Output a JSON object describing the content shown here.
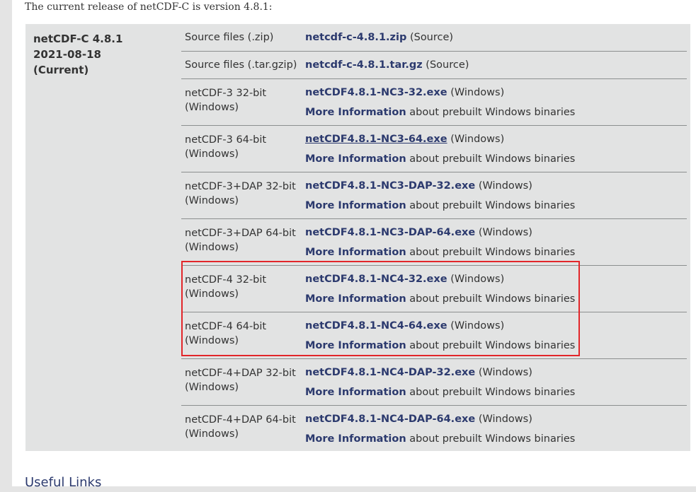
{
  "intro": "The current release of netCDF-C is version 4.8.1:",
  "release": {
    "name": "netCDF-C 4.8.1",
    "date": "2021-08-18",
    "status": "(Current)"
  },
  "rows": [
    {
      "label": "Source files (.zip)",
      "file": "netcdf-c-4.8.1.zip",
      "suffix": "(Source)"
    },
    {
      "label": "Source files (.tar.gzip)",
      "file": "netcdf-c-4.8.1.tar.gz",
      "suffix": "(Source)"
    },
    {
      "label": "netCDF-3 32-bit (Windows)",
      "file": "netCDF4.8.1-NC3-32.exe",
      "suffix": "(Windows)",
      "more": "More Information",
      "more_suffix": "about prebuilt Windows binaries"
    },
    {
      "label": "netCDF-3 64-bit (Windows)",
      "file": "netCDF4.8.1-NC3-64.exe",
      "suffix": "(Windows)",
      "more": "More Information",
      "more_suffix": "about prebuilt Windows binaries"
    },
    {
      "label": "netCDF-3+DAP 32-bit (Windows)",
      "file": "netCDF4.8.1-NC3-DAP-32.exe",
      "suffix": "(Windows)",
      "more": "More Information",
      "more_suffix": "about prebuilt Windows binaries"
    },
    {
      "label": "netCDF-3+DAP 64-bit (Windows)",
      "file": "netCDF4.8.1-NC3-DAP-64.exe",
      "suffix": "(Windows)",
      "more": "More Information",
      "more_suffix": "about prebuilt Windows binaries"
    },
    {
      "label": "netCDF-4 32-bit (Windows)",
      "file": "netCDF4.8.1-NC4-32.exe",
      "suffix": "(Windows)",
      "more": "More Information",
      "more_suffix": "about prebuilt Windows binaries"
    },
    {
      "label": "netCDF-4 64-bit (Windows)",
      "file": "netCDF4.8.1-NC4-64.exe",
      "suffix": "(Windows)",
      "more": "More Information",
      "more_suffix": "about prebuilt Windows binaries"
    },
    {
      "label": "netCDF-4+DAP 32-bit (Windows)",
      "file": "netCDF4.8.1-NC4-DAP-32.exe",
      "suffix": "(Windows)",
      "more": "More Information",
      "more_suffix": "about prebuilt Windows binaries"
    },
    {
      "label": "netCDF-4+DAP 64-bit (Windows)",
      "file": "netCDF4.8.1-NC4-DAP-64.exe",
      "suffix": "(Windows)",
      "more": "More Information",
      "more_suffix": "about prebuilt Windows binaries"
    }
  ],
  "useful_links_heading": "Useful Links",
  "colors": {
    "link": "#2c3a6e",
    "table_bg": "#e2e3e3",
    "highlight": "#e2262a"
  }
}
